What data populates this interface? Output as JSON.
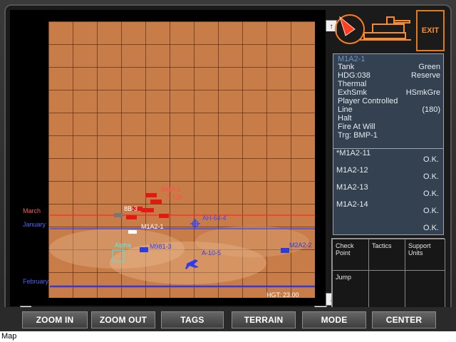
{
  "map": {
    "labels": {
      "march": "March",
      "january": "January",
      "february": "February",
      "alpha": "Alpha",
      "bmp_top": "BMP-1",
      "t72": "T-72b",
      "m1a2": "M1A2-1",
      "ab": "8B-3",
      "ah64": "AH-64-4",
      "m981": "M981-3",
      "a10": "A-10-5",
      "m2a2": "M2A2-2"
    },
    "hgt_label": "HGT:  23.00"
  },
  "unit_info": {
    "title": "M1A2-1",
    "type": "Tank",
    "color": "Green",
    "heading": "HDG:038",
    "reserve": "Reserve",
    "thermal": "Thermal",
    "exhsmk": "ExhSmk",
    "hsmkgre": "HSmkGre",
    "controlled": "Player Controlled",
    "line": "Line",
    "line_value": "(180)",
    "halt": "Halt",
    "fire": "Fire At Will",
    "target": "Trg: BMP-1"
  },
  "units": [
    {
      "name": "*M1A2-11",
      "status": "O.K."
    },
    {
      "name": "M1A2-12",
      "status": "O.K."
    },
    {
      "name": "M1A2-13",
      "status": "O.K."
    },
    {
      "name": "M1A2-14",
      "status": "O.K."
    },
    {
      "name": "",
      "status": "O.K."
    }
  ],
  "commands": {
    "checkpoint": "Check Point",
    "tactics": "Tactics",
    "support": "Support Units",
    "jump": "Jump"
  },
  "exit": "EXIT",
  "buttons": {
    "zoom_in": "ZOOM IN",
    "zoom_out": "ZOOM OUT",
    "tags": "TAGS",
    "terrain": "TERRAIN",
    "mode": "MODE",
    "center": "CENTER"
  },
  "status": "Map",
  "colors": {
    "terrain": "#c87c47",
    "friendly": "#2f39d9",
    "enemy": "#d81e12",
    "neutral": "#ffffff",
    "panel": "#334150",
    "accent": "#ff8a2a"
  }
}
